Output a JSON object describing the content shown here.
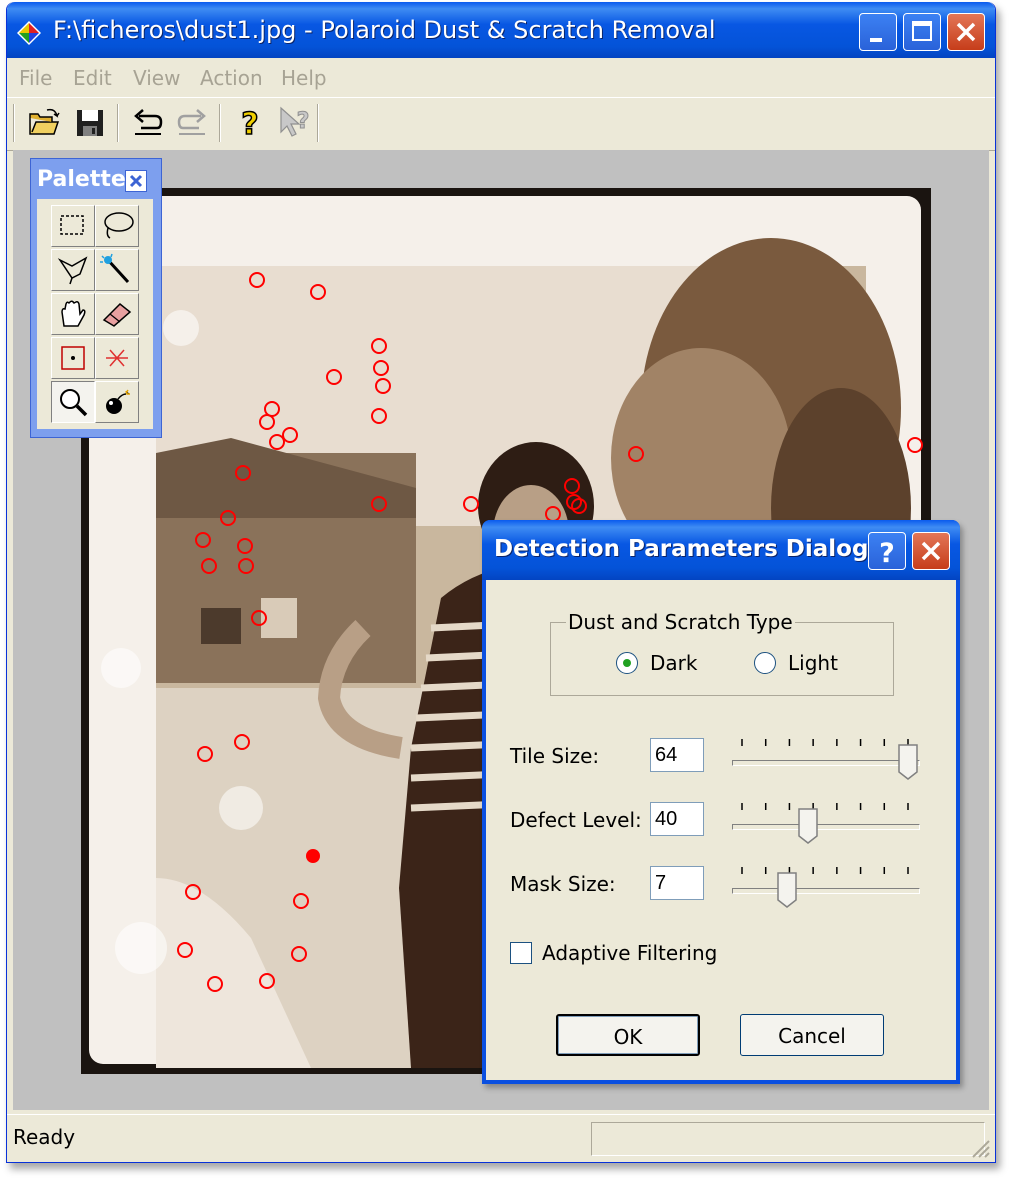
{
  "window": {
    "title": "F:\\ficheros\\dust1.jpg - Polaroid Dust & Scratch Removal"
  },
  "menu": [
    "File",
    "Edit",
    "View",
    "Action",
    "Help"
  ],
  "toolbar": {
    "icons": [
      "open-folder-icon",
      "save-icon",
      "undo-icon",
      "redo-icon",
      "help-icon",
      "context-help-icon"
    ]
  },
  "palette": {
    "title": "Palette",
    "tools": [
      "rectangle-select-icon",
      "lasso-icon",
      "polygon-lasso-icon",
      "magic-wand-icon",
      "hand-icon",
      "eraser-icon",
      "point-marker-icon",
      "cross-marker-icon",
      "zoom-icon",
      "bomb-icon"
    ]
  },
  "dialog": {
    "title": "Detection Parameters Dialog",
    "group_label": "Dust and Scratch Type",
    "radio_dark": "Dark",
    "radio_light": "Light",
    "selected_type": "Dark",
    "tile_size_label": "Tile Size:",
    "tile_size_value": "64",
    "tile_size_fraction": 1.0,
    "defect_level_label": "Defect Level:",
    "defect_level_value": "40",
    "defect_level_fraction": 0.4,
    "mask_size_label": "Mask Size:",
    "mask_size_value": "7",
    "mask_size_fraction": 0.27,
    "adaptive_label": "Adaptive Filtering",
    "adaptive_checked": false,
    "ok_label": "OK",
    "cancel_label": "Cancel"
  },
  "status": {
    "text": "Ready"
  },
  "colors": {
    "titlebar": "#0453d8",
    "marker": "#ff0000",
    "sepia_dark": "#3b2418",
    "frame": "#f5f0ea"
  }
}
